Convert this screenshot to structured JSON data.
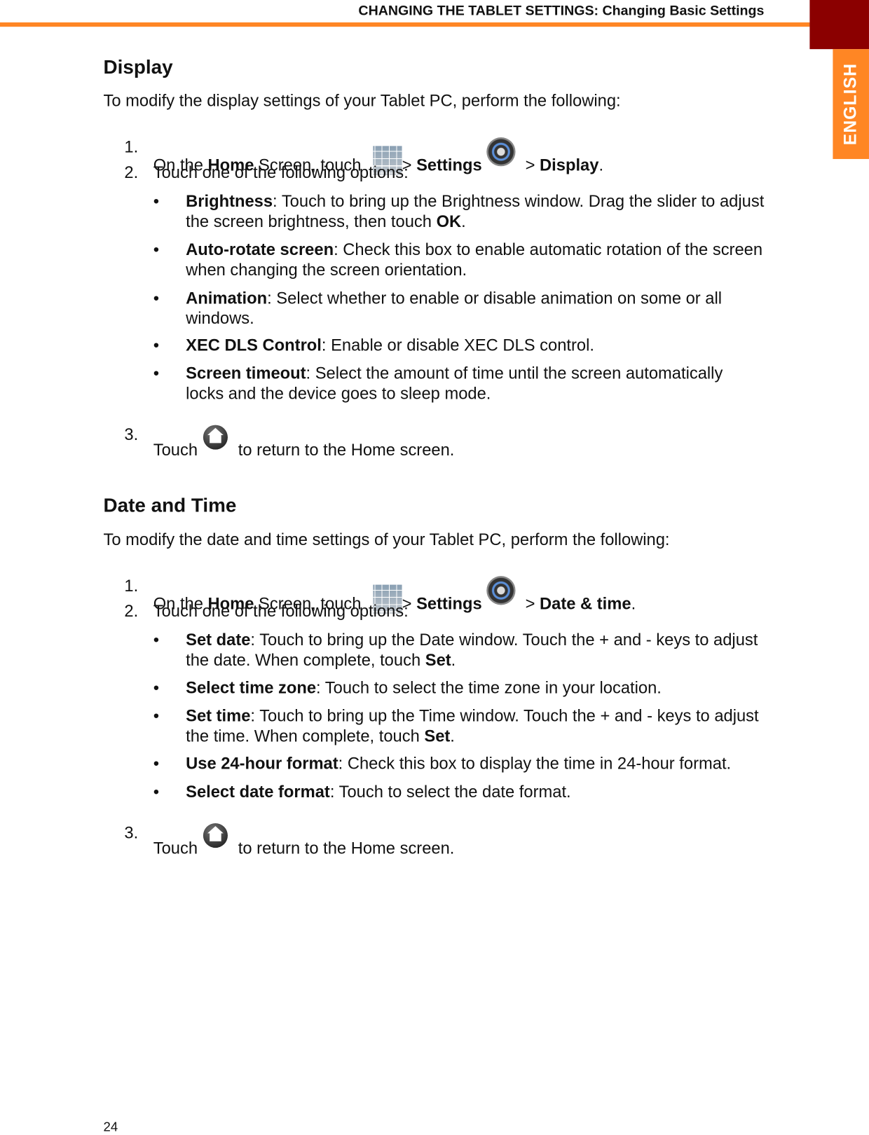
{
  "header": {
    "title": "CHANGING THE TABLET SETTINGS: Changing Basic Settings",
    "tab": "ENGLISH",
    "colors": {
      "accent": "#ff8624",
      "dark_red": "#8b0000"
    }
  },
  "display": {
    "heading": "Display",
    "intro": "To modify the display settings of your Tablet PC, perform the following:",
    "step1": {
      "n": "1.",
      "a": "On the ",
      "b": "Home",
      "c": " Screen, touch ",
      "d": "> ",
      "e": "Settings",
      "f": "> ",
      "g": "Display",
      "h": "."
    },
    "step2": {
      "n": "2.",
      "text": "Touch one of the following options:"
    },
    "bullets": [
      {
        "term": "Brightness",
        "desc": ": Touch to bring up the Brightness window. Drag the slider to adjust the screen brightness, then touch ",
        "end_bold": "OK",
        "end": "."
      },
      {
        "term": "Auto-rotate screen",
        "desc": ": Check this box to enable automatic rotation of the screen when changing the screen orientation."
      },
      {
        "term": "Animation",
        "desc": ": Select whether to enable or disable animation on some or all windows."
      },
      {
        "term": "XEC DLS Control",
        "desc": ": Enable or disable XEC DLS control."
      },
      {
        "term": "Screen timeout",
        "desc": ": Select the amount of time until the screen automatically locks and the device goes to sleep mode."
      }
    ],
    "step3": {
      "n": "3.",
      "a": "Touch",
      "b": "to return to the Home screen."
    }
  },
  "datetime": {
    "heading": "Date and Time",
    "intro": "To modify the date and time settings of your Tablet PC, perform the following:",
    "step1": {
      "n": "1.",
      "a": "On the ",
      "b": "Home",
      "c": " Screen, touch ",
      "d": "> ",
      "e": "Settings",
      "f": "> ",
      "g": "Date & time",
      "h": "."
    },
    "step2": {
      "n": "2.",
      "text": "Touch one of the following options:"
    },
    "bullets": [
      {
        "term": "Set date",
        "desc": ": Touch to bring up the Date window. Touch the + and - keys to adjust the date. When complete, touch ",
        "end_bold": "Set",
        "end": "."
      },
      {
        "term": "Select time zone",
        "desc": ": Touch to select the time zone in your location."
      },
      {
        "term": "Set time",
        "desc": ": Touch to bring up the Time window. Touch the + and - keys to adjust the time. When complete, touch ",
        "end_bold": "Set",
        "end": "."
      },
      {
        "term": "Use 24-hour format",
        "desc": ": Check this box to display the time in 24-hour format."
      },
      {
        "term": "Select date format",
        "desc": ": Touch to select the date format."
      }
    ],
    "step3": {
      "n": "3.",
      "a": "Touch",
      "b": "to return to the Home screen."
    }
  },
  "icons": {
    "apps": "apps-grid-icon",
    "settings": "settings-gear-icon",
    "home": "home-icon"
  },
  "footer": {
    "page_number": "24"
  }
}
